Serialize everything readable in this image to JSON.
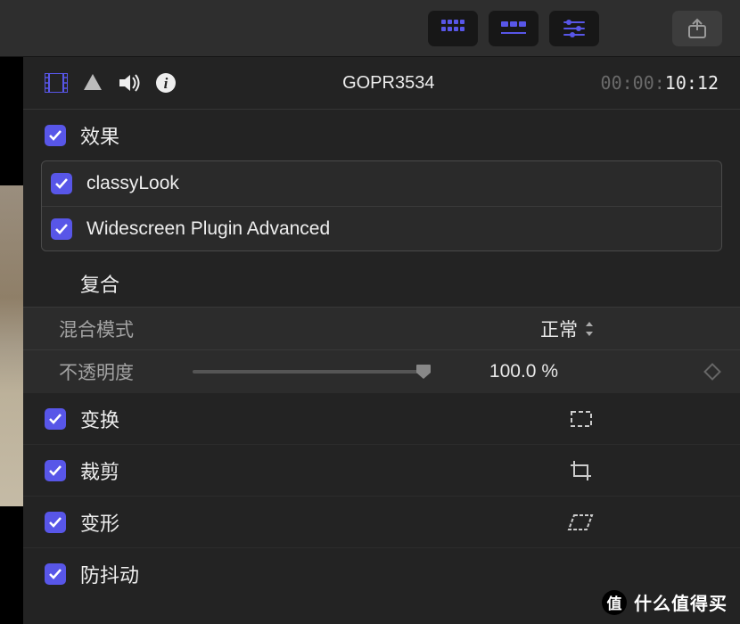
{
  "toolbar": {
    "grid_icon": "grid-view-icon",
    "timeline_icon": "timeline-view-icon",
    "sliders_icon": "inspector-sliders-icon",
    "share_icon": "share-icon"
  },
  "inspector": {
    "clip_title": "GOPR3534",
    "timecode_prefix": "00:00:",
    "timecode_suffix": "10:12"
  },
  "sections": {
    "effects_label": "效果",
    "effects": [
      {
        "name": "classyLook",
        "checked": true
      },
      {
        "name": "Widescreen Plugin Advanced",
        "checked": true
      }
    ],
    "composite": {
      "title": "复合",
      "blend_label": "混合模式",
      "blend_value": "正常",
      "opacity_label": "不透明度",
      "opacity_value": "100.0",
      "opacity_unit": "%"
    },
    "transform_label": "变换",
    "crop_label": "裁剪",
    "distort_label": "变形",
    "stabilize_label": "防抖动"
  },
  "watermark": {
    "badge": "值",
    "text": "什么值得买"
  }
}
